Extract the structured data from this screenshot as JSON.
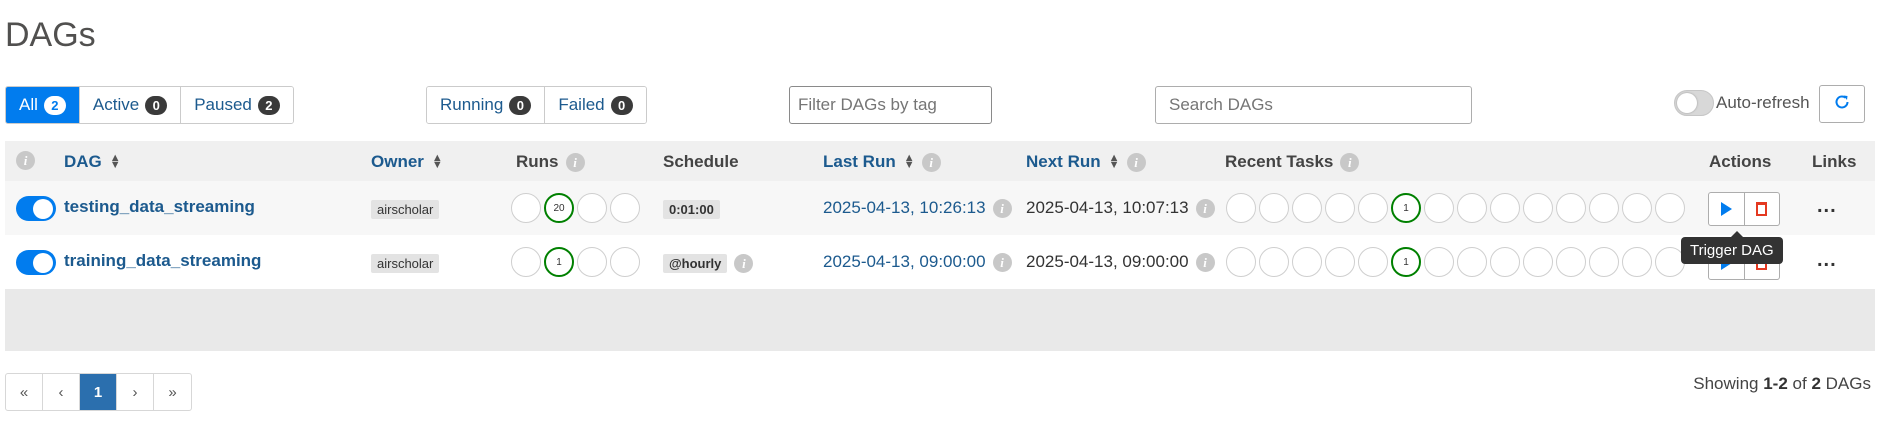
{
  "page": {
    "title": "DAGs"
  },
  "status_filter": [
    {
      "label": "All",
      "count": "2",
      "active": true
    },
    {
      "label": "Active",
      "count": "0"
    },
    {
      "label": "Paused",
      "count": "2"
    }
  ],
  "run_filter": [
    {
      "label": "Running",
      "count": "0"
    },
    {
      "label": "Failed",
      "count": "0"
    }
  ],
  "tag_filter": {
    "placeholder": "Filter DAGs by tag"
  },
  "search": {
    "placeholder": "Search DAGs"
  },
  "auto_refresh": {
    "label": "Auto-refresh",
    "enabled": false
  },
  "table": {
    "headers": {
      "dag": "DAG",
      "owner": "Owner",
      "runs": "Runs",
      "schedule": "Schedule",
      "last_run": "Last Run",
      "next_run": "Next Run",
      "recent_tasks": "Recent Tasks",
      "actions": "Actions",
      "links": "Links"
    },
    "rows": [
      {
        "dag_id": "testing_data_streaming",
        "owner": "airscholar",
        "runs": [
          "",
          "20",
          "",
          ""
        ],
        "schedule": "0:01:00",
        "last_run": "2025-04-13, 10:26:13",
        "next_run": "2025-04-13, 10:07:13",
        "recent_tasks": [
          "",
          "",
          "",
          "",
          "",
          "1",
          "",
          "",
          "",
          "",
          "",
          "",
          "",
          ""
        ],
        "links": "..."
      },
      {
        "dag_id": "training_data_streaming",
        "owner": "airscholar",
        "runs": [
          "",
          "1",
          "",
          ""
        ],
        "schedule": "@hourly",
        "last_run": "2025-04-13, 09:00:00",
        "next_run": "2025-04-13, 09:00:00",
        "recent_tasks": [
          "",
          "",
          "",
          "",
          "",
          "1",
          "",
          "",
          "",
          "",
          "",
          "",
          "",
          ""
        ],
        "links": "..."
      }
    ]
  },
  "tooltip": {
    "text": "Trigger DAG"
  },
  "pagination": {
    "first": "«",
    "prev": "‹",
    "current": "1",
    "next": "›",
    "last": "»"
  },
  "showing": {
    "prefix": "Showing",
    "range": "1-2",
    "of": "of",
    "total": "2",
    "suffix": "DAGs"
  },
  "colors": {
    "accent": "#017cee",
    "success": "#008000",
    "link": "#1c5a8e",
    "danger": "#e43921"
  }
}
